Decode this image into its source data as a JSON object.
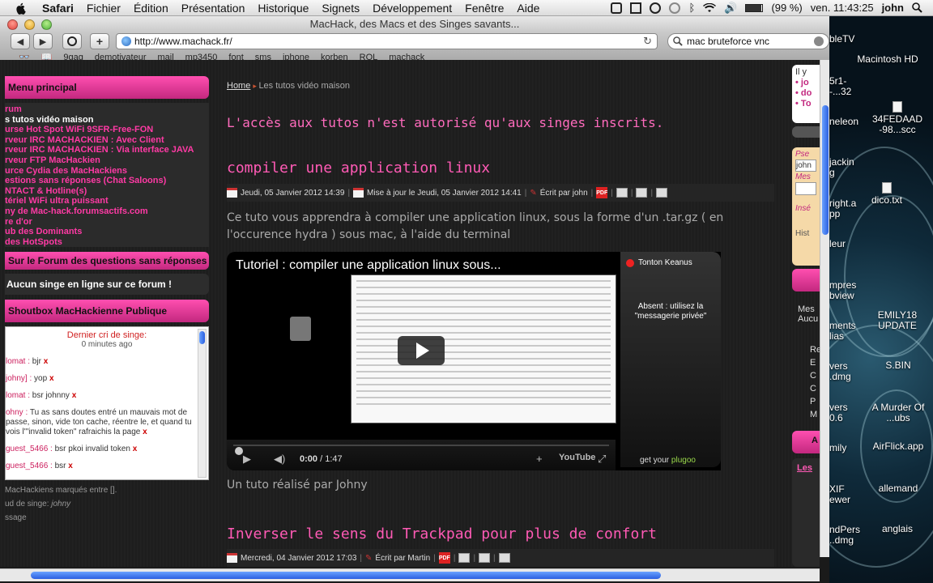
{
  "menubar": {
    "app": "Safari",
    "items": [
      "Fichier",
      "Édition",
      "Présentation",
      "Historique",
      "Signets",
      "Développement",
      "Fenêtre",
      "Aide"
    ],
    "battery": "(99 %)",
    "clock": "ven. 11:43:25",
    "user": "john"
  },
  "window": {
    "title": "MacHack, des Macs et des Singes savants...",
    "url": "http://www.machack.fr/",
    "search": "mac bruteforce vnc",
    "bookmarks": [
      "9gag",
      "demotivateur",
      "mail",
      "mp3450",
      "font",
      "sms",
      "iphone",
      "korben",
      "ROL",
      "machack"
    ]
  },
  "sidebar": {
    "menu_title": "Menu principal",
    "menu_items": [
      "rum",
      "s tutos vidéo maison",
      "urse Hot Spot WiFi 9SFR-Free-FON",
      "rveur IRC MACHACKIEN : Avec Client",
      "rveur IRC MACHACKIEN : Via interface JAVA",
      "rveur FTP MacHackien",
      "urce Cydia des MacHackiens",
      "estions sans réponses (Chat Saloons)",
      "NTACT & Hotline(s)",
      "tériel WiFi ultra puissant",
      "ny de Mac-hack.forumsactifs.com",
      "re d'or",
      "ub des Dominants",
      "des HotSpots"
    ],
    "forum_title": "Sur le Forum des questions sans réponses",
    "online": "Aucun singe en ligne sur ce forum !",
    "shout_title": "Shoutbox MacHackienne Publique",
    "shout_header": "Dernier cri de singe:",
    "shout_time": "0 minutes ago",
    "messages": [
      {
        "nick": "lomat :",
        "text": " bjr "
      },
      {
        "nick": "johny] :",
        "text": " yop "
      },
      {
        "nick": "lomat :",
        "text": " bsr johnny "
      },
      {
        "nick": "ohny :",
        "text": " Tu as sans doutes entré un mauvais mot de passe, sinon, vide ton cache, réentre le, et quand tu vois l'\"invalid token\" rafraichis la page "
      },
      {
        "nick": "guest_5466 :",
        "text": " bsr pkoi invalid token "
      },
      {
        "nick": "guest_5466 :",
        "text": " bsr "
      }
    ],
    "x": "x",
    "bottom1": "MacHackiens marqués entre [].",
    "bottom2": "ud de singe: ",
    "bottom2_name": "johny",
    "bottom3": "ssage"
  },
  "main": {
    "crumb_home": "Home",
    "crumb_current": "Les tutos vidéo maison",
    "notice": "L'accès aux tutos n'est autorisé qu'aux singes inscrits.",
    "post1": {
      "title": "compiler une application linux",
      "date": "Jeudi, 05 Janvier 2012 14:39",
      "updated": "Mise à jour le Jeudi, 05 Janvier 2012 14:41",
      "author": "Écrit par john",
      "pdf": "PDF",
      "intro": "Ce tuto vous apprendra à compiler une application linux, sous la forme d'un .tar.gz ( en l'occurence hydra ) sous mac, à l'aide du terminal",
      "video_title": "Tutoriel : compiler une application linux  sous...",
      "video_time": "0:00",
      "video_duration": "/ 1:47",
      "video_progress": 0,
      "youtube": "YouTube",
      "promo_name": "Tonton Keanus",
      "promo_text": "Absent : utilisez la \"messagerie privée\"",
      "promo_get": "get your ",
      "promo_brand": "plugoo",
      "outro": "Un tuto réalisé par Johny"
    },
    "post2": {
      "title": "Inverser le sens du Trackpad pour plus de confort",
      "date": "Mercredi, 04 Janvier 2012 17:03",
      "author": "Écrit par Martin"
    }
  },
  "right_sidebar": {
    "items": [
      "Il y",
      "jo",
      "do",
      "To",
      "Pse",
      "john",
      "Mes",
      "Insé",
      "Hist",
      "Mes",
      "Aucu",
      "Re",
      "E",
      "C",
      "C",
      "P",
      "M",
      "A",
      "Les"
    ]
  },
  "desktop": {
    "icons": [
      "Macintosh HD",
      "34FEDAAD -98...scc",
      "dico.txt",
      "EMILY18 UPDATE",
      "S.BIN",
      "A Murder Of ...ubs",
      "AirFlick.app",
      "allemand",
      "anglais"
    ],
    "partial": [
      "bleTV",
      "5r1-",
      "-...32",
      "neleon",
      "jackin",
      "g",
      "right.a",
      "pp",
      "leur",
      "mpres",
      "bview",
      "ments",
      "lias",
      "vers",
      ".dmg",
      "vers",
      "0.6",
      "mily",
      "XIF",
      "ewer",
      "ndPers",
      "..dmg"
    ]
  }
}
